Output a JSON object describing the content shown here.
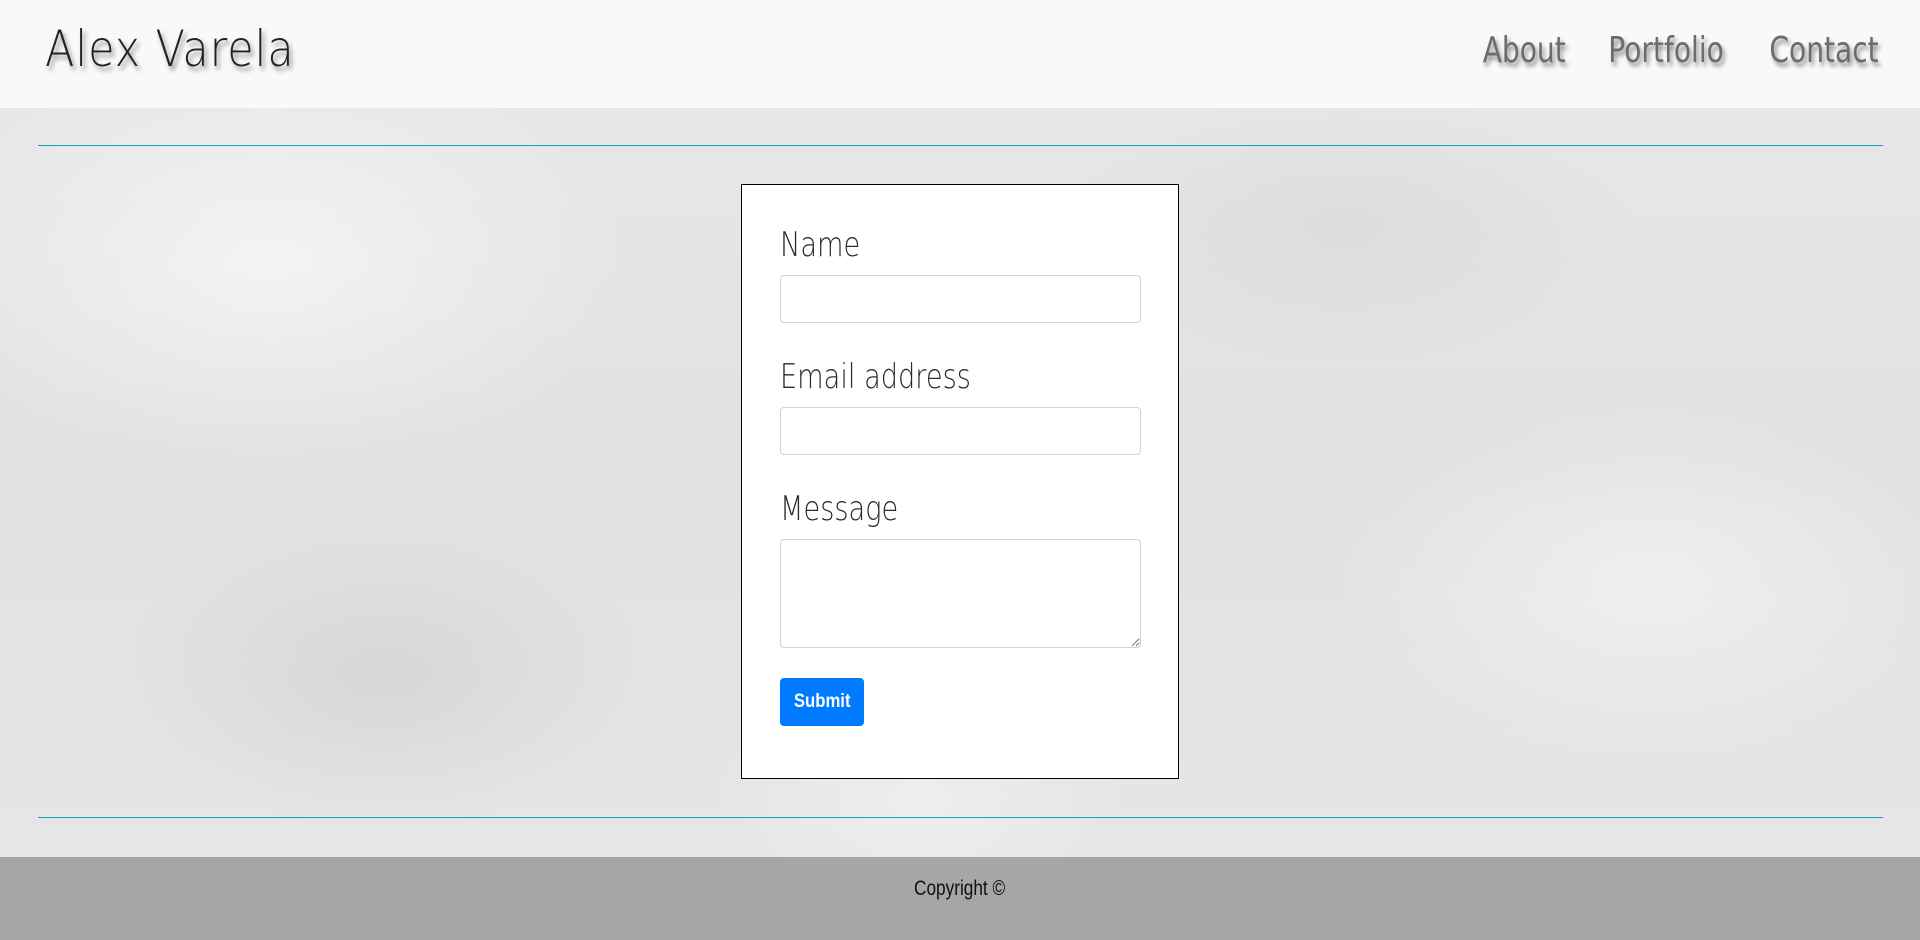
{
  "navbar": {
    "brand": "Alex Varela",
    "links": [
      {
        "label": "About"
      },
      {
        "label": "Portfolio"
      },
      {
        "label": "Contact"
      }
    ]
  },
  "form": {
    "name_label": "Name",
    "name_value": "",
    "email_label": "Email address",
    "email_value": "",
    "message_label": "Message",
    "message_value": "",
    "submit_label": "Submit"
  },
  "footer": {
    "text": "Copyright ©"
  },
  "colors": {
    "accent_line": "#17a2b8",
    "primary_button": "#007bff",
    "navbar_bg": "#f8f9fa",
    "footer_bg": "#a6a6a6"
  }
}
